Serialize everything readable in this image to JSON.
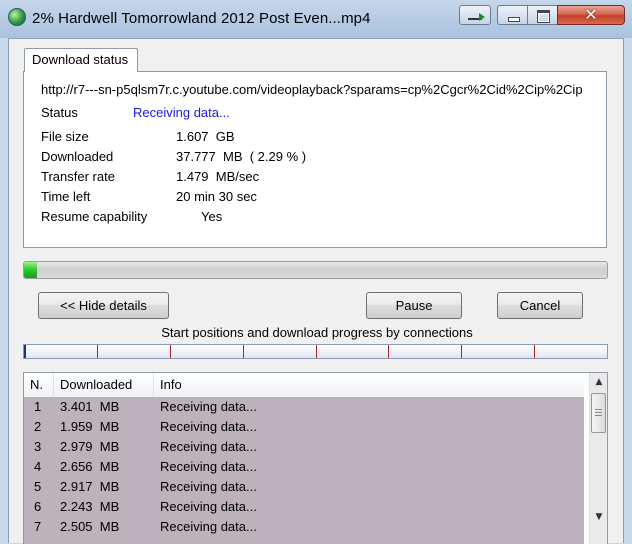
{
  "window": {
    "title": "2% Hardwell Tomorrowland 2012 Post Even...mp4",
    "controls": {
      "minimize_icon": "minimize-icon",
      "maximize_icon": "maximize-icon",
      "close_glyph": "✕"
    }
  },
  "tab": {
    "label": "Download status"
  },
  "info": {
    "url": "http://r7---sn-p5qlsm7r.c.youtube.com/videoplayback?sparams=cp%2Cgcr%2Cid%2Cip%2Cip",
    "status_label": "Status",
    "status_value": "Receiving data...",
    "fields": [
      {
        "label": "File size",
        "value": "1.607  GB"
      },
      {
        "label": "Downloaded",
        "value": "37.777  MB  ( 2.29 % )"
      },
      {
        "label": "Transfer rate",
        "value": "1.479  MB/sec"
      },
      {
        "label": "Time left",
        "value": "20 min 30 sec"
      },
      {
        "label": "Resume capability",
        "value": "       Yes"
      }
    ]
  },
  "progress": {
    "percent": 2.29
  },
  "buttons": {
    "hide_details": "<< Hide details",
    "pause": "Pause",
    "cancel": "Cancel"
  },
  "connections": {
    "caption": "Start positions and download progress by connections",
    "count": 8
  },
  "list": {
    "headers": {
      "n": "N.",
      "downloaded": "Downloaded",
      "info": "Info"
    },
    "rows": [
      {
        "n": "1",
        "downloaded": "3.401  MB",
        "info": "Receiving data..."
      },
      {
        "n": "2",
        "downloaded": "1.959  MB",
        "info": "Receiving data..."
      },
      {
        "n": "3",
        "downloaded": "2.979  MB",
        "info": "Receiving data..."
      },
      {
        "n": "4",
        "downloaded": "2.656  MB",
        "info": "Receiving data..."
      },
      {
        "n": "5",
        "downloaded": "2.917  MB",
        "info": "Receiving data..."
      },
      {
        "n": "6",
        "downloaded": "2.243  MB",
        "info": "Receiving data..."
      },
      {
        "n": "7",
        "downloaded": "2.505  MB",
        "info": "Receiving data..."
      }
    ],
    "row_background": "#bdb2bb"
  }
}
